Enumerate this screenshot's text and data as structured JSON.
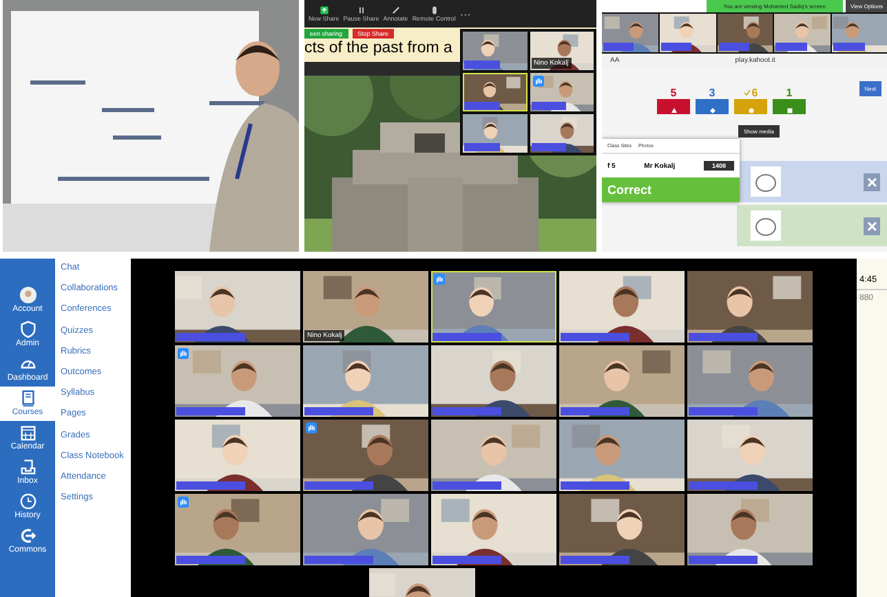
{
  "screen_share": {
    "toolbar": [
      {
        "label": "New Share"
      },
      {
        "label": "Pause Share"
      },
      {
        "label": "Annotate"
      },
      {
        "label": "Remote Control"
      }
    ],
    "more": "···",
    "sharing_label": "een sharing",
    "stop_button": "Stop Share",
    "slide_title": "cts of the past from a",
    "thumbnails": [
      {
        "hand_raised": false,
        "speaking": false
      },
      {
        "name": "Nino Kokalj",
        "hand_raised": false,
        "speaking": false
      },
      {
        "hand_raised": false,
        "speaking": true
      },
      {
        "hand_raised": true,
        "speaking": false
      },
      {
        "hand_raised": false,
        "speaking": false
      },
      {
        "hand_raised": false,
        "speaking": false
      }
    ]
  },
  "kahoot_share": {
    "banner": "You are viewing Mohamed Sadiq's screen",
    "view_options": "View Options",
    "thumbnails": [
      {
        "hand_raised": false,
        "speaking": false
      },
      {
        "hand_raised": false,
        "speaking": false
      },
      {
        "hand_raised": false,
        "speaking": false
      },
      {
        "hand_raised": false,
        "speaking": false
      },
      {
        "hand_raised": false,
        "speaking": false
      }
    ],
    "address": "play.kahoot.it",
    "text_size": "AA",
    "results": [
      {
        "count": "5",
        "color": "#c8102e",
        "correct": false
      },
      {
        "count": "3",
        "color": "#2f6fc7",
        "correct": false
      },
      {
        "count": "6",
        "color": "#d4a20a",
        "correct": true
      },
      {
        "count": "1",
        "color": "#3a8f1b",
        "correct": false
      }
    ],
    "next_button": "Next",
    "show_media": "Show media",
    "answers": [
      {
        "color": "#c9d6ee",
        "close": "×"
      },
      {
        "color": "#cfe2c6",
        "close": "×"
      }
    ],
    "popup": {
      "bookmarks": [
        "Class Sites",
        "Photos"
      ],
      "rank": "f 5",
      "player": "Mr Kokalj",
      "score": "1408",
      "result": "Correct"
    }
  },
  "canvas_nav": [
    {
      "label": "Account",
      "selected": false
    },
    {
      "label": "Admin",
      "selected": false
    },
    {
      "label": "Dashboard",
      "selected": false
    },
    {
      "label": "Courses",
      "selected": true
    },
    {
      "label": "Calendar",
      "selected": false
    },
    {
      "label": "Inbox",
      "selected": false
    },
    {
      "label": "History",
      "selected": false
    },
    {
      "label": "Commons",
      "selected": false
    }
  ],
  "course_nav": [
    "Chat",
    "Collaborations",
    "Conferences",
    "Quizzes",
    "Rubrics",
    "Outcomes",
    "Syllabus",
    "Pages",
    "Grades",
    "Class Notebook",
    "Attendance",
    "Settings"
  ],
  "gallery": [
    {
      "hand_raised": false,
      "speaking": false
    },
    {
      "name": "Nino Kokalj",
      "hand_raised": false,
      "speaking": false
    },
    {
      "hand_raised": true,
      "speaking": true
    },
    {
      "hand_raised": false,
      "speaking": false
    },
    {
      "hand_raised": false,
      "speaking": false
    },
    {
      "hand_raised": true,
      "speaking": false
    },
    {
      "hand_raised": false,
      "speaking": false
    },
    {
      "hand_raised": false,
      "speaking": false
    },
    {
      "hand_raised": false,
      "speaking": false
    },
    {
      "hand_raised": false,
      "speaking": false
    },
    {
      "hand_raised": false,
      "speaking": false
    },
    {
      "hand_raised": true,
      "speaking": false
    },
    {
      "hand_raised": false,
      "speaking": false
    },
    {
      "hand_raised": false,
      "speaking": false
    },
    {
      "hand_raised": false,
      "speaking": false
    },
    {
      "hand_raised": true,
      "speaking": false
    },
    {
      "hand_raised": false,
      "speaking": false
    },
    {
      "hand_raised": false,
      "speaking": false
    },
    {
      "hand_raised": false,
      "speaking": false
    },
    {
      "hand_raised": false,
      "speaking": false
    }
  ],
  "gallery_partial": {
    "hand_raised": false,
    "speaking": false
  },
  "side_panel": {
    "time": "4:45",
    "number": "880"
  }
}
